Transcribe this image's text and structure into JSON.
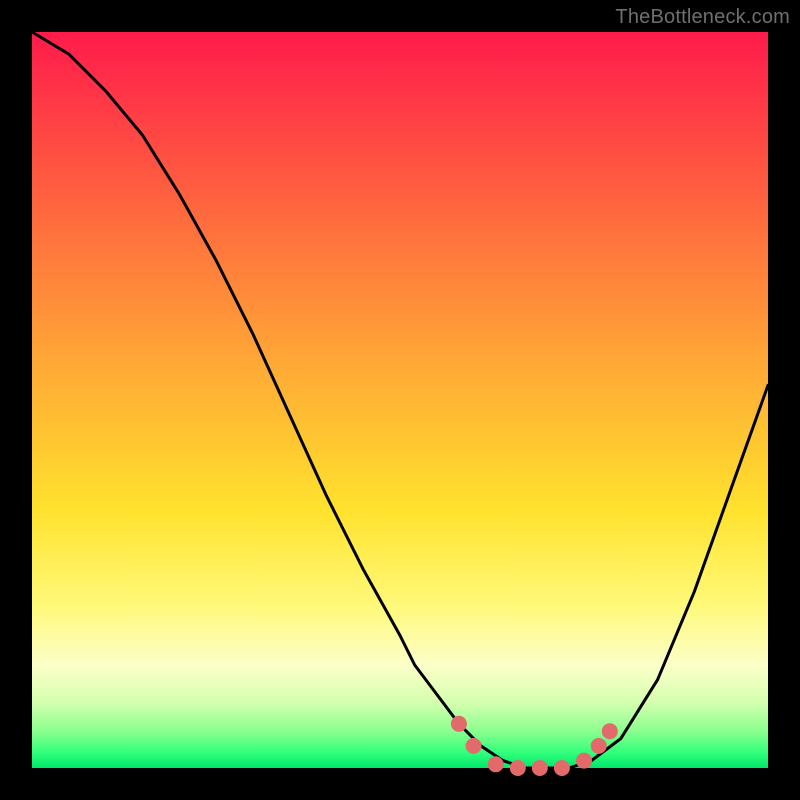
{
  "watermark": "TheBottleneck.com",
  "colors": {
    "background": "#000000",
    "curve": "#000000",
    "marker": "#e26a6a",
    "gradient_stops": [
      "#ff1b4b",
      "#ff3a46",
      "#ff6a3e",
      "#ffa836",
      "#ffe22d",
      "#fff97a",
      "#fcffc8",
      "#d6ffb0",
      "#8bff8f",
      "#2fff7a",
      "#00e86b"
    ]
  },
  "chart_data": {
    "type": "line",
    "title": "",
    "xlabel": "",
    "ylabel": "",
    "xlim": [
      0,
      100
    ],
    "ylim": [
      0,
      100
    ],
    "grid": false,
    "series": [
      {
        "name": "bottleneck-curve",
        "x": [
          0,
          5,
          10,
          15,
          20,
          25,
          30,
          35,
          40,
          45,
          50,
          52,
          55,
          58,
          61,
          64,
          67,
          70,
          73,
          76,
          80,
          85,
          90,
          95,
          100
        ],
        "values": [
          100,
          97,
          92,
          86,
          78,
          69,
          59,
          48,
          37,
          27,
          18,
          14,
          10,
          6,
          3,
          1,
          0,
          0,
          0,
          1,
          4,
          12,
          24,
          38,
          52
        ]
      }
    ],
    "markers": [
      {
        "name": "optimal-band-left-1",
        "x": 58,
        "y": 6
      },
      {
        "name": "optimal-band-left-2",
        "x": 60,
        "y": 3
      },
      {
        "name": "optimal-band-bottom-1",
        "x": 63,
        "y": 0.5
      },
      {
        "name": "optimal-band-bottom-2",
        "x": 66,
        "y": 0
      },
      {
        "name": "optimal-band-bottom-3",
        "x": 69,
        "y": 0
      },
      {
        "name": "optimal-band-bottom-4",
        "x": 72,
        "y": 0
      },
      {
        "name": "optimal-band-right-1",
        "x": 75,
        "y": 1
      },
      {
        "name": "optimal-band-right-2",
        "x": 77,
        "y": 3
      },
      {
        "name": "optimal-band-right-3",
        "x": 78.5,
        "y": 5
      }
    ]
  }
}
